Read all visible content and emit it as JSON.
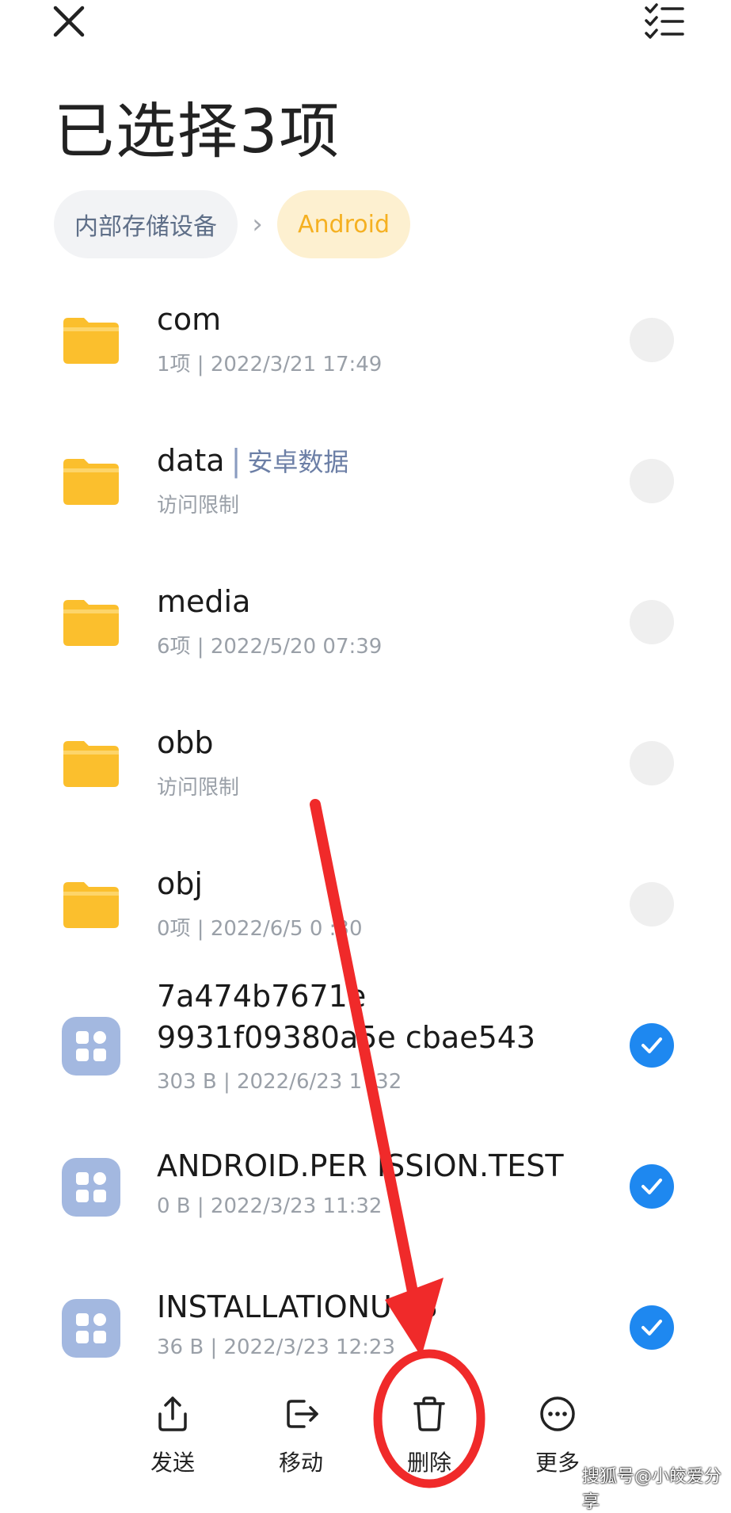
{
  "title": "已选择3项",
  "breadcrumb": {
    "root": "内部存储设备",
    "current": "Android"
  },
  "files": [
    {
      "name": "com",
      "tag": "",
      "meta": "1项 | 2022/3/21 17:49",
      "type": "folder",
      "selected": false
    },
    {
      "name": "data",
      "tag": "安卓数据",
      "meta": "访问限制",
      "type": "folder",
      "selected": false
    },
    {
      "name": "media",
      "tag": "",
      "meta": "6项 | 2022/5/20 07:39",
      "type": "folder",
      "selected": false
    },
    {
      "name": "obb",
      "tag": "",
      "meta": "访问限制",
      "type": "folder",
      "selected": false
    },
    {
      "name": "obj",
      "tag": "",
      "meta": "0项 | 2022/6/5 0 :30",
      "type": "folder",
      "selected": false
    },
    {
      "name": "7a474b7671e 9931f09380a5e cbae543",
      "tag": "",
      "meta": "303 B | 2022/6/23 1 :32",
      "type": "file",
      "selected": true
    },
    {
      "name": "ANDROID.PER ISSION.TEST",
      "tag": "",
      "meta": "0 B | 2022/3/23 11:32",
      "type": "file",
      "selected": true
    },
    {
      "name": "INSTALLATIONU LS",
      "tag": "",
      "meta": "36 B | 2022/3/23 12:23",
      "type": "file",
      "selected": true
    }
  ],
  "actions": {
    "send": "发送",
    "move": "移动",
    "delete": "删除",
    "more": "更多"
  },
  "colors": {
    "accent": "#1e88f0",
    "folder": "#fbbf2d",
    "annotation": "#f02a2a"
  },
  "watermark": "搜狐号@小皎爱分享"
}
